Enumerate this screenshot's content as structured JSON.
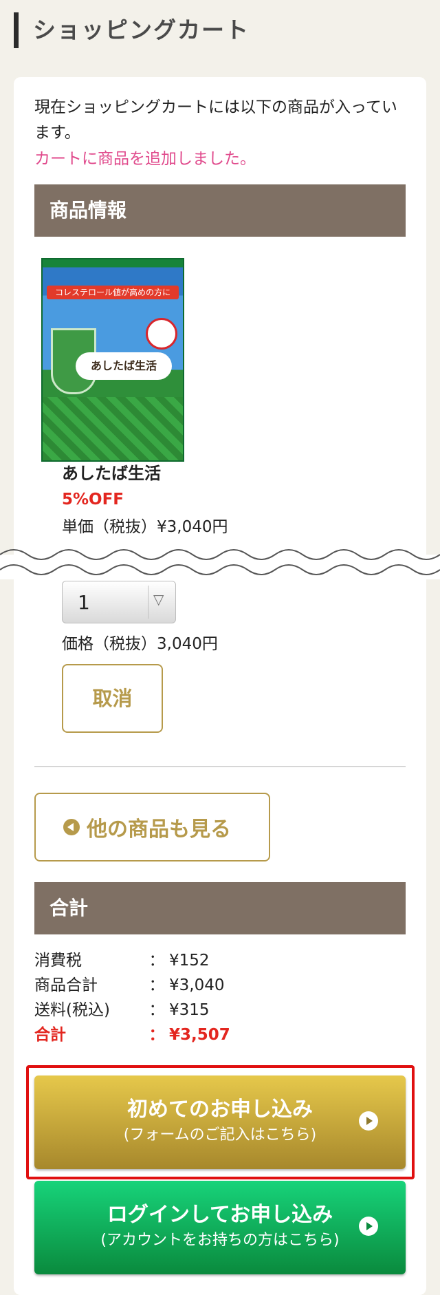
{
  "header": {
    "title": "ショッピングカート"
  },
  "cart": {
    "intro": "現在ショッピングカートには以下の商品が入っています。",
    "added_notice": "カートに商品を追加しました。"
  },
  "product_section": {
    "title": "商品情報",
    "item": {
      "image_text": "コレステロール値が高めの方に",
      "package_brand": "あしたば生活",
      "name": "あしたば生活",
      "discount": "5%OFF",
      "unit_price": "単価（税抜）¥3,040円",
      "quantity": "1",
      "line_price": "価格（税抜）3,040円",
      "cancel_label": "取消"
    }
  },
  "more_products_label": "他の商品も見る",
  "totals_section": {
    "title": "合計",
    "rows": [
      {
        "label": "消費税",
        "colon": "：",
        "value": "¥152"
      },
      {
        "label": "商品合計",
        "colon": "：",
        "value": "¥3,040"
      },
      {
        "label": "送料(税込)",
        "colon": "：",
        "value": "¥315"
      },
      {
        "label": "合計",
        "colon": "：",
        "value": "¥3,507"
      }
    ]
  },
  "actions": {
    "first_time": {
      "main": "初めてのお申し込み",
      "sub": "(フォームのご記入はこちら)"
    },
    "login": {
      "main": "ログインしてお申し込み",
      "sub": "(アカウントをお持ちの方はこちら)"
    }
  },
  "colors": {
    "section_header_bg": "#7f7064",
    "accent_gold": "#b69a4b",
    "notice_pink": "#e04a8c",
    "price_red": "#e3261f",
    "cta_gold": "#c9a93a",
    "cta_green": "#12b55d",
    "highlight_red": "#e01010"
  }
}
